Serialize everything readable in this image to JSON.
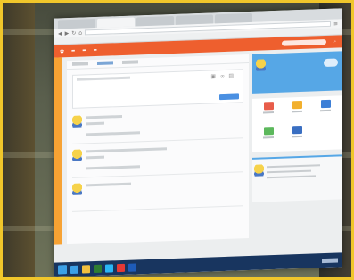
{
  "scene": {
    "description_kind": "photo-of-projected-screen",
    "accent_colors": {
      "frame": "#f0c62b",
      "app_bar": "#ee5f2e",
      "side_strip": "#f7a233",
      "profile_card": "#56a7e6",
      "post_button": "#4a90e2",
      "taskbar": "#18355f"
    }
  },
  "browser": {
    "tabs_count": 5,
    "nav_icons": [
      "back-icon",
      "forward-icon",
      "refresh-icon",
      "home-icon"
    ]
  },
  "app": {
    "logo_icon": "app-logo-icon",
    "search_icon": "search-icon"
  },
  "feed": {
    "composer_icons": [
      "image-icon",
      "link-icon",
      "file-icon"
    ],
    "post_count": 2
  },
  "sidebar": {
    "widget_icons": [
      "image-icon",
      "folder-icon",
      "scissors-icon",
      "text-icon",
      "document-icon"
    ],
    "weather_icon": "cloud-icon"
  },
  "taskbar": {
    "start_icon": "windows-start-icon",
    "app_icons": [
      "ie-icon",
      "folder-icon",
      "store-icon",
      "chat-icon",
      "browser-icon",
      "word-icon"
    ]
  }
}
